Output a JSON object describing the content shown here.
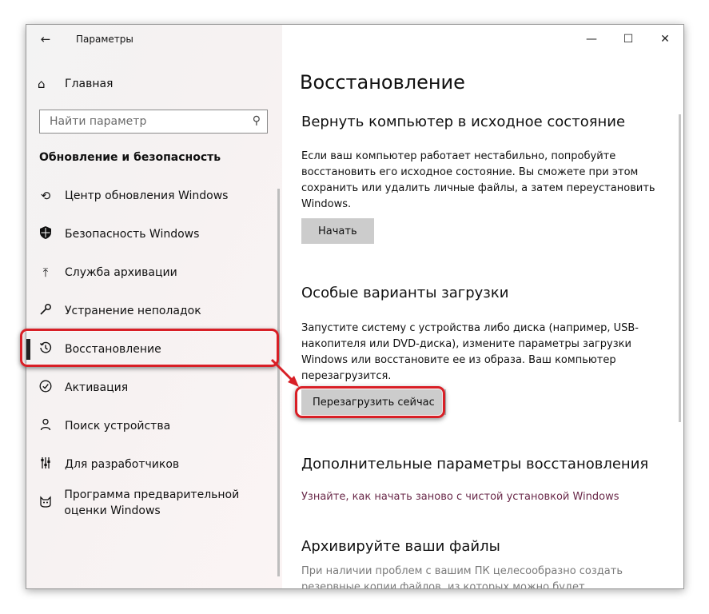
{
  "titlebar": {
    "title": "Параметры",
    "back_icon": "arrow-left-icon"
  },
  "window_controls": {
    "minimize": "—",
    "maximize": "☐",
    "close": "✕"
  },
  "sidebar": {
    "home_label": "Главная",
    "search_placeholder": "Найти параметр",
    "section_title": "Обновление и безопасность",
    "items": [
      {
        "label": "Центр обновления Windows",
        "icon": "sync-icon"
      },
      {
        "label": "Безопасность Windows",
        "icon": "shield-icon"
      },
      {
        "label": "Служба архивации",
        "icon": "upload-icon"
      },
      {
        "label": "Устранение неполадок",
        "icon": "wrench-icon"
      },
      {
        "label": "Восстановление",
        "icon": "history-icon",
        "active": true
      },
      {
        "label": "Активация",
        "icon": "check-circle-icon"
      },
      {
        "label": "Поиск устройства",
        "icon": "person-locate-icon"
      },
      {
        "label": "Для разработчиков",
        "icon": "sliders-icon"
      },
      {
        "label": "Программа предварительной оценки Windows",
        "icon": "insider-cat-icon"
      }
    ]
  },
  "main": {
    "title": "Восстановление",
    "reset": {
      "heading": "Вернуть компьютер в исходное состояние",
      "text": "Если ваш компьютер работает нестабильно, попробуйте восстановить его исходное состояние. Вы сможете при этом сохранить или удалить личные файлы, а затем переустановить Windows.",
      "button": "Начать"
    },
    "advanced_startup": {
      "heading": "Особые варианты загрузки",
      "text": "Запустите систему с устройства либо диска (например, USB-накопителя или DVD-диска), измените параметры загрузки Windows или восстановите ее из образа. Ваш компьютер перезагрузится.",
      "button": "Перезагрузить сейчас"
    },
    "more_options": {
      "heading": "Дополнительные параметры восстановления",
      "link": "Узнайте, как начать заново с чистой установкой Windows"
    },
    "backup": {
      "heading": "Архивируйте ваши файлы",
      "text": "При наличии проблем с вашим ПК целесообразно создать резервные копии файлов, из которых можно будет восстановить"
    }
  },
  "annotations": {
    "highlight_color": "#d81f26"
  }
}
